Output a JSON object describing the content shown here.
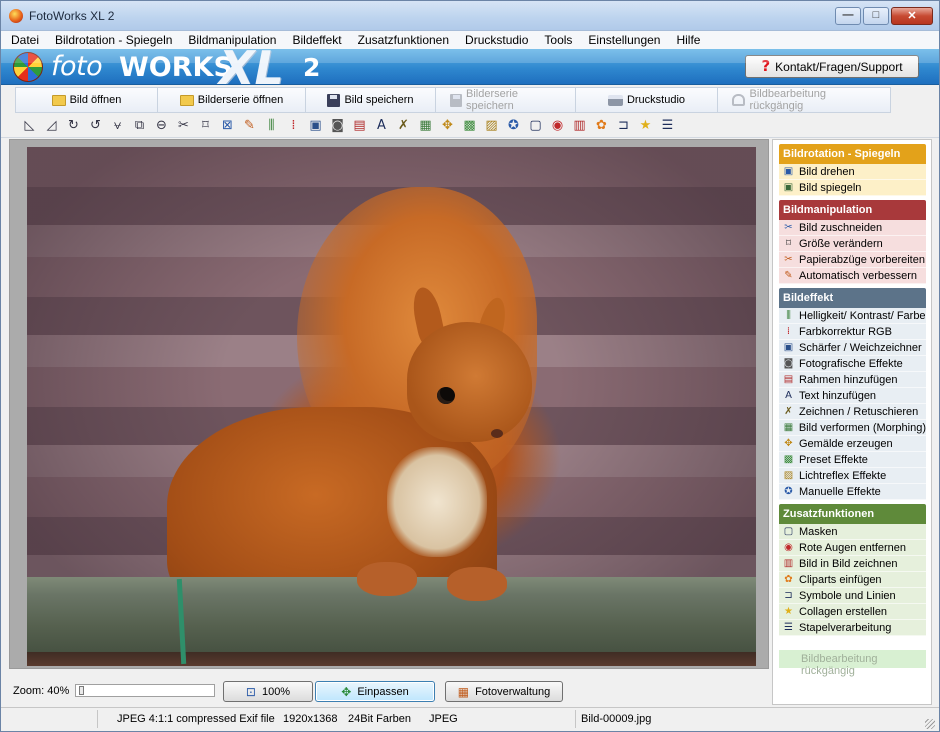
{
  "window": {
    "title": "FotoWorks XL 2",
    "controls": {
      "minimize": "—",
      "maximize": "□",
      "close": "✕"
    }
  },
  "menu": [
    "Datei",
    "Bildrotation - Spiegeln",
    "Bildmanipulation",
    "Bildeffekt",
    "Zusatzfunktionen",
    "Druckstudio",
    "Tools",
    "Einstellungen",
    "Hilfe"
  ],
  "banner": {
    "logo_foto": "foto",
    "logo_works": "WORKS",
    "logo_xl": "XL",
    "logo_num": "2",
    "contact_label": "Kontakt/Fragen/Support",
    "contact_icon": "?"
  },
  "actions": [
    {
      "label": "Bild öffnen",
      "icon": "folder-icon",
      "enabled": true
    },
    {
      "label": "Bilderserie öffnen",
      "icon": "folder-icon",
      "enabled": true
    },
    {
      "label": "Bild speichern",
      "icon": "disk-icon",
      "enabled": true
    },
    {
      "label": "Bilderserie speichern",
      "icon": "disk-icon",
      "enabled": false
    },
    {
      "label": "Druckstudio",
      "icon": "printer-icon",
      "enabled": true
    },
    {
      "label": "Bildbearbeitung rückgängig",
      "icon": "undo-icon",
      "enabled": false
    }
  ],
  "toolbar_icons": [
    {
      "name": "rotate-left-icon",
      "glyph": "◺",
      "color": "#334"
    },
    {
      "name": "rotate-right-icon",
      "glyph": "◿",
      "color": "#334"
    },
    {
      "name": "rotate-cw-icon",
      "glyph": "↻",
      "color": "#334"
    },
    {
      "name": "rotate-ccw-icon",
      "glyph": "↺",
      "color": "#334"
    },
    {
      "name": "mirror-icon",
      "glyph": "⩝",
      "color": "#334"
    },
    {
      "name": "flip-icon",
      "glyph": "⧉",
      "color": "#334"
    },
    {
      "name": "perspective-icon",
      "glyph": "⊖",
      "color": "#334"
    },
    {
      "name": "cut-icon",
      "glyph": "✂",
      "color": "#334"
    },
    {
      "name": "crop-icon",
      "glyph": "⌑",
      "color": "#334"
    },
    {
      "name": "resize-icon",
      "glyph": "⊠",
      "color": "#2a5aa8"
    },
    {
      "name": "paper-icon",
      "glyph": "✎",
      "color": "#c05a1a"
    },
    {
      "name": "brightness-icon",
      "glyph": "⫼",
      "color": "#2e7a2e"
    },
    {
      "name": "color-rgb-icon",
      "glyph": "⁞",
      "color": "#c0282b"
    },
    {
      "name": "sharpen-icon",
      "glyph": "▣",
      "color": "#2a4f8a"
    },
    {
      "name": "photo-effect-icon",
      "glyph": "◙",
      "color": "#555"
    },
    {
      "name": "frame-icon",
      "glyph": "▤",
      "color": "#b02a2a"
    },
    {
      "name": "text-icon",
      "glyph": "A",
      "color": "#1c2c5a"
    },
    {
      "name": "draw-icon",
      "glyph": "✗",
      "color": "#6a5a1a"
    },
    {
      "name": "morph-icon",
      "glyph": "▦",
      "color": "#3a7a3a"
    },
    {
      "name": "paint-icon",
      "glyph": "✥",
      "color": "#c08a1a"
    },
    {
      "name": "preset-icon",
      "glyph": "▩",
      "color": "#3a8a3a"
    },
    {
      "name": "lightflex-icon",
      "glyph": "▨",
      "color": "#a8801a"
    },
    {
      "name": "manual-effect-icon",
      "glyph": "✪",
      "color": "#2a5aa8"
    },
    {
      "name": "mask-icon",
      "glyph": "▢",
      "color": "#1c2c5a"
    },
    {
      "name": "red-eye-icon",
      "glyph": "◉",
      "color": "#c0282b"
    },
    {
      "name": "pip-icon",
      "glyph": "▥",
      "color": "#b02a2a"
    },
    {
      "name": "clipart-icon",
      "glyph": "✿",
      "color": "#e07a1a"
    },
    {
      "name": "symbol-icon",
      "glyph": "⊐",
      "color": "#1c2c5a"
    },
    {
      "name": "collage-icon",
      "glyph": "★",
      "color": "#e0b01a"
    },
    {
      "name": "batch-icon",
      "glyph": "☰",
      "color": "#1c2c5a"
    }
  ],
  "zoom": {
    "label": "Zoom: 40%",
    "level_percent": 40,
    "buttons": [
      {
        "label": "100%",
        "icon": "fit-100-icon",
        "glyph": "⊡",
        "active": false
      },
      {
        "label": "Einpassen",
        "icon": "fit-window-icon",
        "glyph": "✥",
        "active": true
      },
      {
        "label": "Fotoverwaltung",
        "icon": "photo-manager-icon",
        "glyph": "▦",
        "active": false
      }
    ]
  },
  "panel": {
    "sections": [
      {
        "title": "Bildrotation - Spiegeln",
        "theme": "s-orange",
        "items": [
          {
            "label": "Bild drehen",
            "icon": "rotate-icon",
            "glyph": "▣",
            "color": "#2a5aa8"
          },
          {
            "label": "Bild spiegeln",
            "icon": "mirror-icon",
            "glyph": "▣",
            "color": "#3a6a3a"
          }
        ]
      },
      {
        "title": "Bildmanipulation",
        "theme": "s-red",
        "items": [
          {
            "label": "Bild zuschneiden",
            "icon": "crop-icon",
            "glyph": "✂",
            "color": "#2a5aa8"
          },
          {
            "label": "Größe verändern",
            "icon": "resize-icon",
            "glyph": "⌑",
            "color": "#333"
          },
          {
            "label": "Papierabzüge vorbereiten",
            "icon": "paper-icon",
            "glyph": "✂",
            "color": "#c05a1a"
          },
          {
            "label": "Automatisch verbessern",
            "icon": "auto-enhance-icon",
            "glyph": "✎",
            "color": "#c05a1a"
          }
        ]
      },
      {
        "title": "Bildeffekt",
        "theme": "s-blue",
        "items": [
          {
            "label": "Helligkeit/ Kontrast/ Farbe",
            "icon": "brightness-icon",
            "glyph": "⫼",
            "color": "#2e7a2e"
          },
          {
            "label": "Farbkorrektur RGB",
            "icon": "color-rgb-icon",
            "glyph": "⁞",
            "color": "#c0282b"
          },
          {
            "label": "Schärfer / Weichzeichner",
            "icon": "sharpen-icon",
            "glyph": "▣",
            "color": "#2a4f8a"
          },
          {
            "label": "Fotografische Effekte",
            "icon": "photo-effect-icon",
            "glyph": "◙",
            "color": "#555"
          },
          {
            "label": "Rahmen hinzufügen",
            "icon": "frame-icon",
            "glyph": "▤",
            "color": "#b02a2a"
          },
          {
            "label": "Text hinzufügen",
            "icon": "text-icon",
            "glyph": "A",
            "color": "#1c2c5a"
          },
          {
            "label": "Zeichnen / Retuschieren",
            "icon": "draw-icon",
            "glyph": "✗",
            "color": "#6a5a1a"
          },
          {
            "label": "Bild verformen (Morphing)",
            "icon": "morph-icon",
            "glyph": "▦",
            "color": "#3a7a3a"
          },
          {
            "label": "Gemälde erzeugen",
            "icon": "paint-icon",
            "glyph": "✥",
            "color": "#c08a1a"
          },
          {
            "label": "Preset Effekte",
            "icon": "preset-icon",
            "glyph": "▩",
            "color": "#3a8a3a"
          },
          {
            "label": "Lichtreflex Effekte",
            "icon": "lightflex-icon",
            "glyph": "▨",
            "color": "#a8801a"
          },
          {
            "label": "Manuelle Effekte",
            "icon": "manual-effect-icon",
            "glyph": "✪",
            "color": "#2a5aa8"
          }
        ]
      },
      {
        "title": "Zusatzfunktionen",
        "theme": "s-green",
        "items": [
          {
            "label": "Masken",
            "icon": "mask-icon",
            "glyph": "▢",
            "color": "#1c2c5a"
          },
          {
            "label": "Rote Augen entfernen",
            "icon": "red-eye-icon",
            "glyph": "◉",
            "color": "#c0282b"
          },
          {
            "label": "Bild in Bild zeichnen",
            "icon": "pip-icon",
            "glyph": "▥",
            "color": "#b02a2a"
          },
          {
            "label": "Cliparts einfügen",
            "icon": "clipart-icon",
            "glyph": "✿",
            "color": "#e07a1a"
          },
          {
            "label": "Symbole und Linien",
            "icon": "symbol-icon",
            "glyph": "⊐",
            "color": "#1c2c5a"
          },
          {
            "label": "Collagen erstellen",
            "icon": "collage-icon",
            "glyph": "★",
            "color": "#e0b01a"
          },
          {
            "label": "Stapelverarbeitung",
            "icon": "batch-icon",
            "glyph": "☰",
            "color": "#1c2c5a"
          }
        ]
      }
    ],
    "undo_label": "Bildbearbeitung rückgängig"
  },
  "status": {
    "format": "JPEG 4:1:1 compressed Exif file",
    "dimensions": "1920x1368",
    "color_depth": "24Bit Farben",
    "type": "JPEG",
    "filename": "Bild-00009.jpg"
  }
}
